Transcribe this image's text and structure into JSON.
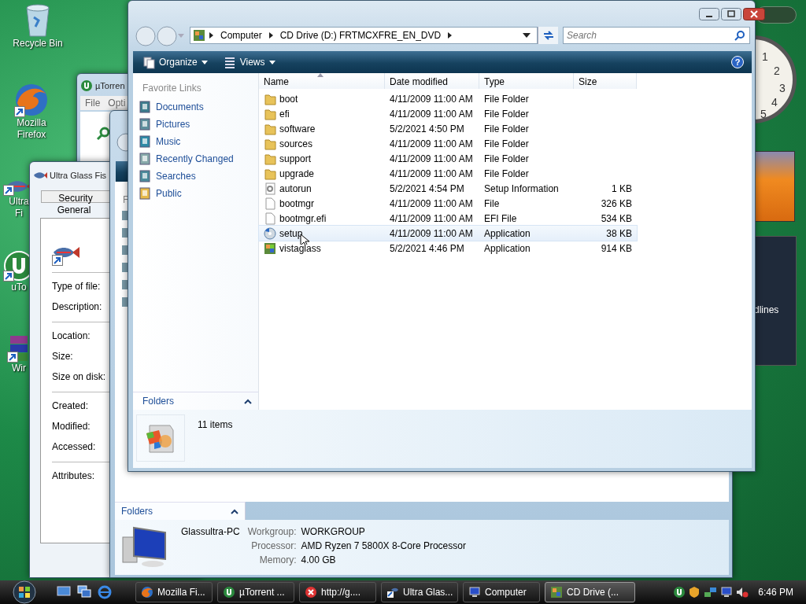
{
  "desktop_icons": [
    {
      "kind": "bin",
      "lines": [
        "Recycle Bin"
      ]
    },
    {
      "kind": "browser",
      "lines": [
        "Mozilla",
        "Firefox"
      ]
    },
    {
      "kind": "fish",
      "lines": [
        "Ultra",
        "Fi"
      ]
    },
    {
      "kind": "torrent",
      "lines": [
        "uTo"
      ]
    },
    {
      "kind": "archive",
      "lines": [
        "Wir"
      ]
    }
  ],
  "gadgets": {
    "clock_numerals": [
      "1",
      "2",
      "3",
      "4",
      "5"
    ],
    "news_text": "dlines"
  },
  "utorrent_window": {
    "title": "µTorren",
    "menu": [
      "File",
      "Opti"
    ]
  },
  "properties_window": {
    "title": "Ultra Glass Fis",
    "tabs": [
      {
        "label": "Security",
        "selected": false
      },
      {
        "label": "General",
        "selected": true
      }
    ],
    "field_groups": [
      [
        "Type of file:",
        "Description:"
      ],
      [
        "Location:",
        "Size:",
        "Size on disk:"
      ],
      [
        "Created:",
        "Modified:",
        "Accessed:"
      ],
      [
        "Attributes:"
      ]
    ]
  },
  "computer_window": {
    "pane_fragment": "F",
    "folders_label": "Folders",
    "computer_name": "Glassultra-PC",
    "details": [
      {
        "label": "Workgroup:",
        "value": "WORKGROUP"
      },
      {
        "label": "Processor:",
        "value": "AMD Ryzen 7 5800X 8-Core Processor"
      },
      {
        "label": "Memory:",
        "value": "4.00 GB"
      }
    ]
  },
  "explorer": {
    "breadcrumb": [
      "Computer",
      "CD Drive (D:) FRTMCXFRE_EN_DVD"
    ],
    "search": {
      "placeholder": "Search"
    },
    "toolbar": [
      "Organize",
      "Views"
    ],
    "help_label": "?",
    "favorite_links_title": "Favorite Links",
    "favorite_links": [
      {
        "kind": "documents",
        "label": "Documents"
      },
      {
        "kind": "pictures",
        "label": "Pictures"
      },
      {
        "kind": "music",
        "label": "Music"
      },
      {
        "kind": "recent",
        "label": "Recently Changed"
      },
      {
        "kind": "searches",
        "label": "Searches"
      },
      {
        "kind": "public",
        "label": "Public"
      }
    ],
    "folders_label": "Folders",
    "columns": [
      {
        "label": "Name",
        "sorted": true
      },
      {
        "label": "Date modified",
        "sorted": false
      },
      {
        "label": "Type",
        "sorted": false
      },
      {
        "label": "Size",
        "sorted": false
      }
    ],
    "rows": [
      {
        "kind": "folder",
        "name": "boot",
        "date": "4/11/2009 11:00 AM",
        "type": "File Folder",
        "size": "",
        "highlighted": false
      },
      {
        "kind": "folder",
        "name": "efi",
        "date": "4/11/2009 11:00 AM",
        "type": "File Folder",
        "size": "",
        "highlighted": false
      },
      {
        "kind": "folder",
        "name": "software",
        "date": "5/2/2021 4:50 PM",
        "type": "File Folder",
        "size": "",
        "highlighted": false
      },
      {
        "kind": "folder",
        "name": "sources",
        "date": "4/11/2009 11:00 AM",
        "type": "File Folder",
        "size": "",
        "highlighted": false
      },
      {
        "kind": "folder",
        "name": "support",
        "date": "4/11/2009 11:00 AM",
        "type": "File Folder",
        "size": "",
        "highlighted": false
      },
      {
        "kind": "folder",
        "name": "upgrade",
        "date": "4/11/2009 11:00 AM",
        "type": "File Folder",
        "size": "",
        "highlighted": false
      },
      {
        "kind": "settings",
        "name": "autorun",
        "date": "5/2/2021 4:54 PM",
        "type": "Setup Information",
        "size": "1 KB",
        "highlighted": false
      },
      {
        "kind": "file",
        "name": "bootmgr",
        "date": "4/11/2009 11:00 AM",
        "type": "File",
        "size": "326 KB",
        "highlighted": false
      },
      {
        "kind": "file",
        "name": "bootmgr.efi",
        "date": "4/11/2009 11:00 AM",
        "type": "EFI File",
        "size": "534 KB",
        "highlighted": false
      },
      {
        "kind": "installer",
        "name": "setup",
        "date": "4/11/2009 11:00 AM",
        "type": "Application",
        "size": "38 KB",
        "highlighted": true
      },
      {
        "kind": "app",
        "name": "vistaglass",
        "date": "5/2/2021 4:46 PM",
        "type": "Application",
        "size": "914 KB",
        "highlighted": false
      }
    ],
    "status": "11 items"
  },
  "taskbar": {
    "tasks": [
      {
        "kind": "browser",
        "label": "Mozilla Fi...",
        "selected": false
      },
      {
        "kind": "torrent",
        "label": "µTorrent ...",
        "selected": false
      },
      {
        "kind": "error",
        "label": "http://g....",
        "selected": false
      },
      {
        "kind": "fish",
        "label": "Ultra Glas...",
        "selected": false
      },
      {
        "kind": "computer",
        "label": "Computer",
        "selected": false
      },
      {
        "kind": "app",
        "label": "CD Drive (...",
        "selected": true
      }
    ],
    "time": "6:46 PM"
  }
}
